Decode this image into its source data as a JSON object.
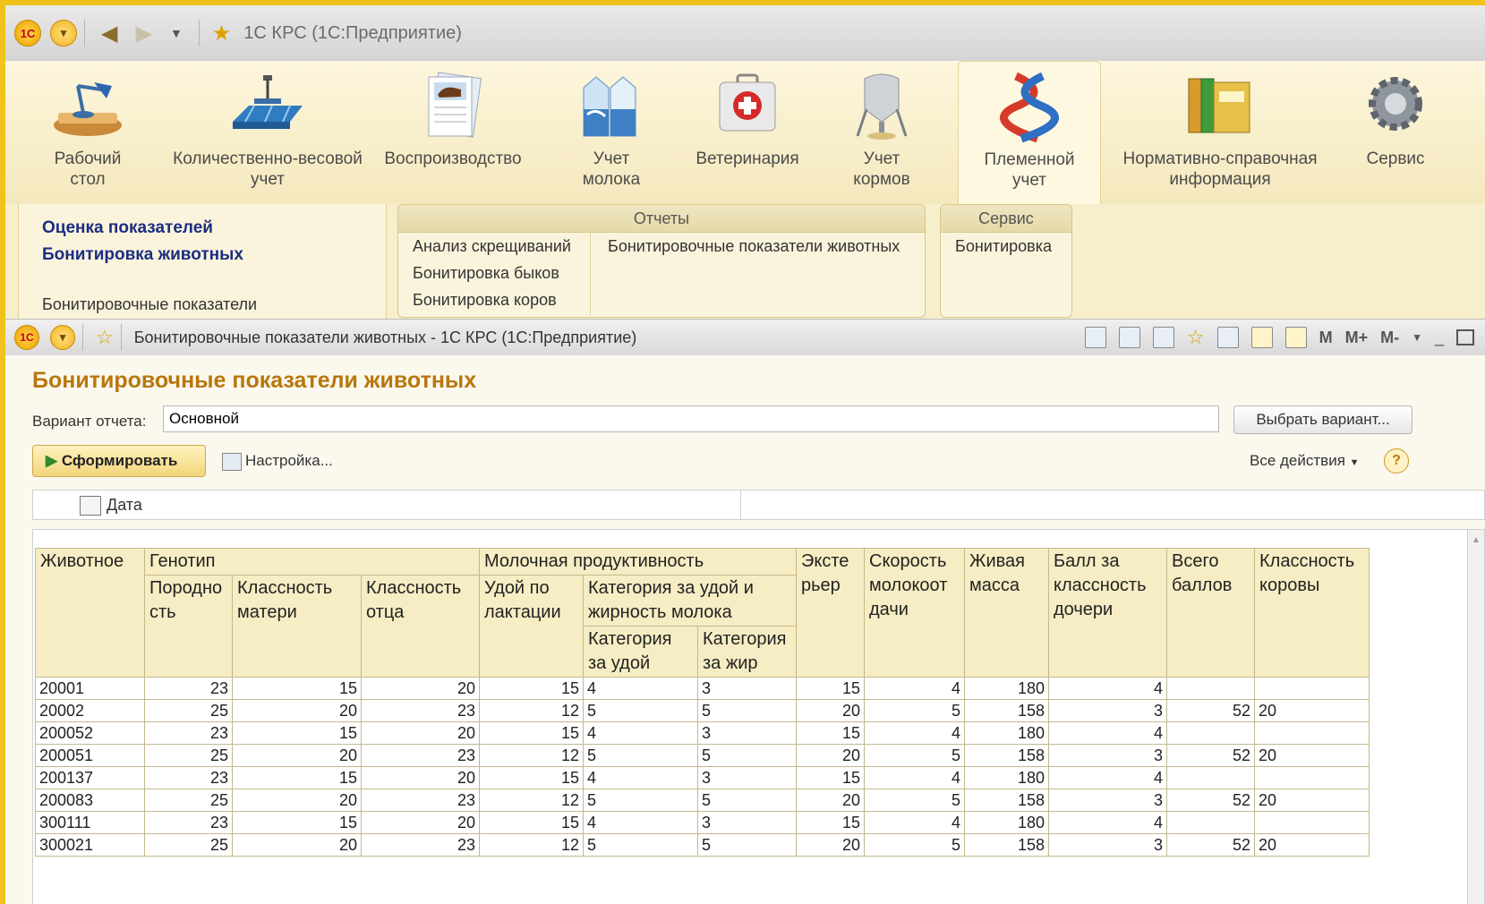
{
  "app_title": "1С КРС  (1С:Предприятие)",
  "sections": [
    {
      "label": "Рабочий\nстол",
      "icon": "desk-lamp-icon"
    },
    {
      "label": "Количественно-весовой\nучет",
      "icon": "scales-icon"
    },
    {
      "label": "Воспроизводство",
      "icon": "cow-document-icon"
    },
    {
      "label": "Учет\nмолока",
      "icon": "milk-cartons-icon"
    },
    {
      "label": "Ветеринария",
      "icon": "first-aid-kit-icon"
    },
    {
      "label": "Учет\nкормов",
      "icon": "feed-silo-icon"
    },
    {
      "label": "Племенной\nучет",
      "icon": "dna-helix-icon"
    },
    {
      "label": "Нормативно-справочная\nинформация",
      "icon": "binders-icon"
    },
    {
      "label": "Сервис",
      "icon": "gear-icon"
    }
  ],
  "nav": {
    "links": [
      "Оценка показателей",
      "Бонитировка животных"
    ],
    "plain": "Бонитировочные показатели"
  },
  "groups": {
    "reports": {
      "title": "Отчеты",
      "items": [
        "Анализ скрещиваний",
        "Бонитировка быков",
        "Бонитировка коров",
        "Бонитировочные показатели животных"
      ]
    },
    "service": {
      "title": "Сервис",
      "items": [
        "Бонитировка"
      ]
    }
  },
  "window": {
    "title": "Бонитировочные показатели животных - 1С КРС  (1С:Предприятие)",
    "memory_buttons": [
      "M",
      "M+",
      "M-"
    ]
  },
  "form": {
    "title": "Бонитировочные показатели животных",
    "variant_label": "Вариант отчета:",
    "variant_value": "Основной",
    "choose_variant": "Выбрать вариант...",
    "generate": "Сформировать",
    "settings": "Настройка...",
    "all_actions": "Все действия",
    "help": "?",
    "date_label": "Дата"
  },
  "table": {
    "header": {
      "animal": "Животное",
      "genotype": "Генотип",
      "breed": "Породно сть",
      "mother_class": "Классность матери",
      "father_class": "Классность отца",
      "milk_prod": "Молочная продуктивность",
      "yield_lact": "Удой по лактации",
      "cat_yield_fat": "Категория за удой и жирность молока",
      "cat_yield": "Категория за удой",
      "cat_fat": "Категория за жир",
      "exterior": "Эксте рьер",
      "milk_speed": "Скорость молокоот дачи",
      "live_weight": "Живая масса",
      "daughter_score": "Балл за классность дочери",
      "total": "Всего баллов",
      "cow_class": "Классность коровы"
    },
    "rows": [
      [
        "20001",
        "23",
        "15",
        "20",
        "15",
        "4",
        "3",
        "15",
        "4",
        "180",
        "4",
        "",
        ""
      ],
      [
        "20002",
        "25",
        "20",
        "23",
        "12",
        "5",
        "5",
        "20",
        "5",
        "158",
        "3",
        "52",
        "20"
      ],
      [
        "200052",
        "23",
        "15",
        "20",
        "15",
        "4",
        "3",
        "15",
        "4",
        "180",
        "4",
        "",
        ""
      ],
      [
        "200051",
        "25",
        "20",
        "23",
        "12",
        "5",
        "5",
        "20",
        "5",
        "158",
        "3",
        "52",
        "20"
      ],
      [
        "200137",
        "23",
        "15",
        "20",
        "15",
        "4",
        "3",
        "15",
        "4",
        "180",
        "4",
        "",
        ""
      ],
      [
        "200083",
        "25",
        "20",
        "23",
        "12",
        "5",
        "5",
        "20",
        "5",
        "158",
        "3",
        "52",
        "20"
      ],
      [
        "300111",
        "23",
        "15",
        "20",
        "15",
        "4",
        "3",
        "15",
        "4",
        "180",
        "4",
        "",
        ""
      ],
      [
        "300021",
        "25",
        "20",
        "23",
        "12",
        "5",
        "5",
        "20",
        "5",
        "158",
        "3",
        "52",
        "20"
      ]
    ]
  }
}
